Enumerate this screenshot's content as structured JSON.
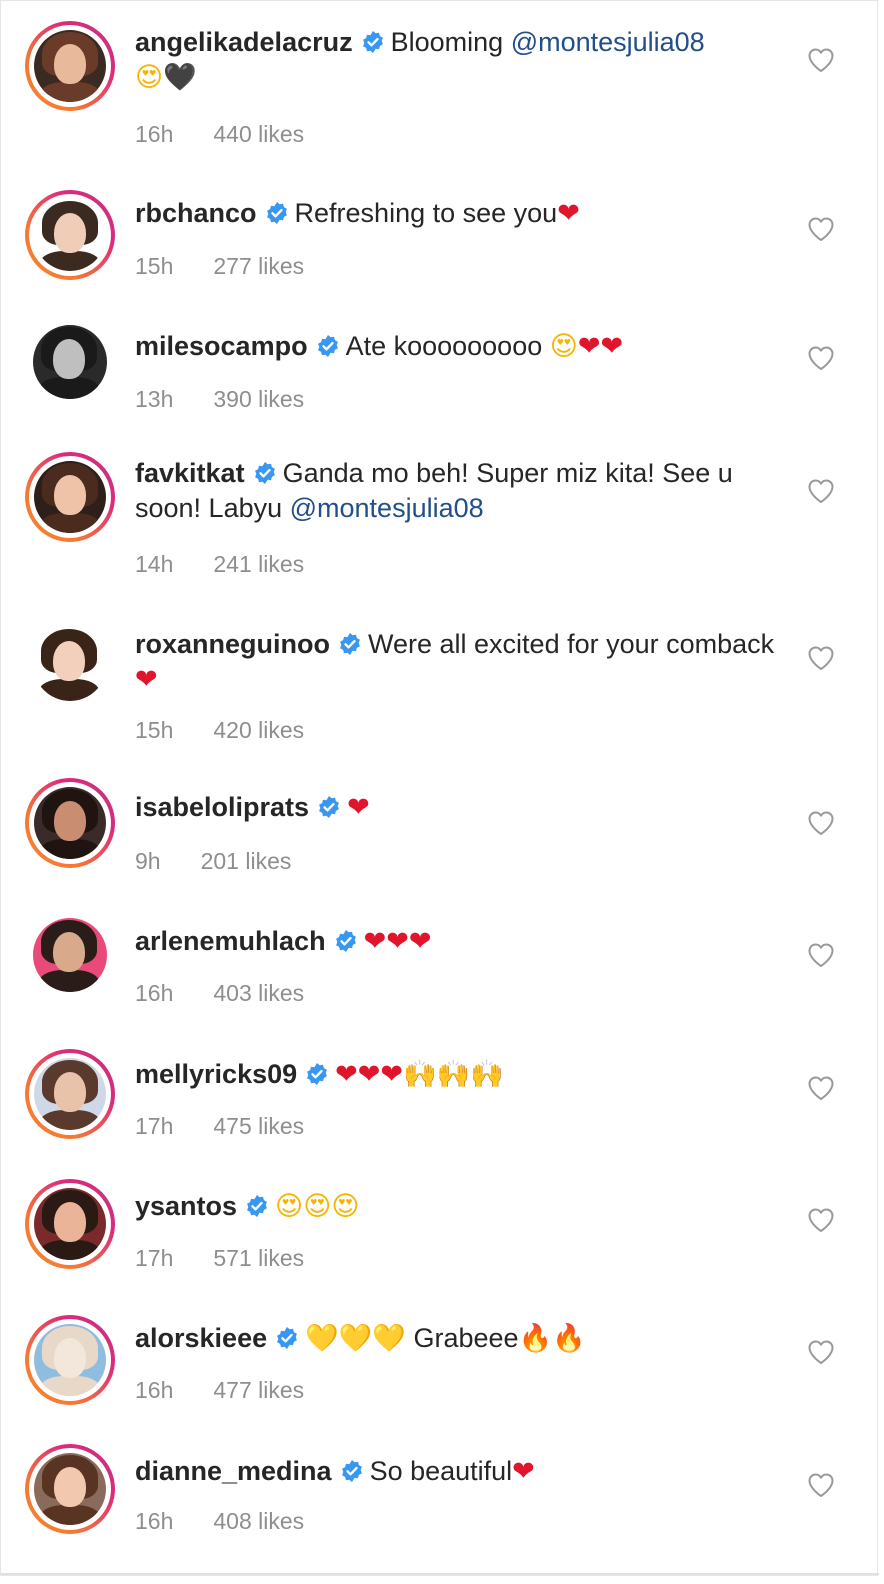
{
  "comments": [
    {
      "username": "angelikadelacruz",
      "text": "Blooming ",
      "mention": "@montesjulia08",
      "emoji": [
        {
          "char": "😍",
          "color": "#f5b400"
        },
        {
          "char": "🖤",
          "color": "#111111"
        }
      ],
      "time": "16h",
      "likes": "440 likes",
      "story_ring": true
    },
    {
      "username": "rbchanco",
      "text": "Refreshing to see you",
      "mention": "",
      "emoji": [
        {
          "char": "❤",
          "color": "#e0142b"
        }
      ],
      "time": "15h",
      "likes": "277 likes",
      "story_ring": true
    },
    {
      "username": "milesocampo",
      "text": "Ate kooooooooo ",
      "mention": "",
      "emoji": [
        {
          "char": "😍",
          "color": "#f5b400"
        },
        {
          "char": "❤",
          "color": "#e0142b"
        },
        {
          "char": "❤",
          "color": "#e0142b"
        }
      ],
      "time": "13h",
      "likes": "390 likes",
      "story_ring": false
    },
    {
      "username": "favkitkat",
      "text": "Ganda mo beh! Super miz kita! See u soon! Labyu ",
      "mention": "@montesjulia08",
      "emoji": [],
      "time": "14h",
      "likes": "241 likes",
      "story_ring": true
    },
    {
      "username": "roxanneguinoo",
      "text": "Were all excited for your comback",
      "mention": "",
      "emoji": [
        {
          "char": "❤",
          "color": "#e0142b"
        }
      ],
      "time": "15h",
      "likes": "420 likes",
      "story_ring": false
    },
    {
      "username": "isabeloliprats",
      "text": "",
      "mention": "",
      "emoji": [
        {
          "char": "❤",
          "color": "#e0142b"
        }
      ],
      "time": "9h",
      "likes": "201 likes",
      "story_ring": true
    },
    {
      "username": "arlenemuhlach",
      "text": "",
      "mention": "",
      "emoji": [
        {
          "char": "❤",
          "color": "#e0142b"
        },
        {
          "char": "❤",
          "color": "#e0142b"
        },
        {
          "char": "❤",
          "color": "#e0142b"
        }
      ],
      "time": "16h",
      "likes": "403 likes",
      "story_ring": false
    },
    {
      "username": "mellyricks09",
      "text": "",
      "mention": "",
      "emoji": [
        {
          "char": "❤",
          "color": "#e0142b"
        },
        {
          "char": "❤",
          "color": "#e0142b"
        },
        {
          "char": "❤",
          "color": "#e0142b"
        },
        {
          "char": "🙌",
          "color": "#f4c20d"
        },
        {
          "char": "🙌",
          "color": "#f4c20d"
        },
        {
          "char": "🙌",
          "color": "#f4c20d"
        }
      ],
      "time": "17h",
      "likes": "475 likes",
      "story_ring": true
    },
    {
      "username": "ysantos",
      "text": "",
      "mention": "",
      "emoji": [
        {
          "char": "😍",
          "color": "#f5b400"
        },
        {
          "char": "😍",
          "color": "#f5b400"
        },
        {
          "char": "😍",
          "color": "#f5b400"
        }
      ],
      "time": "17h",
      "likes": "571 likes",
      "story_ring": true
    },
    {
      "username": "alorskieee",
      "text": "",
      "mention": "",
      "emoji": [
        {
          "char": "💛",
          "color": "#f4c20d"
        },
        {
          "char": "💛",
          "color": "#f4c20d"
        },
        {
          "char": "💛",
          "color": "#f4c20d"
        }
      ],
      "text_after": " Grabeee",
      "emoji_after": [
        {
          "char": "🔥",
          "color": "#f26a1b"
        },
        {
          "char": "🔥",
          "color": "#f26a1b"
        }
      ],
      "time": "16h",
      "likes": "477 likes",
      "story_ring": true
    },
    {
      "username": "dianne_medina",
      "text": "So beautiful",
      "mention": "",
      "emoji": [
        {
          "char": "❤",
          "color": "#e0142b"
        }
      ],
      "time": "16h",
      "likes": "408 likes",
      "story_ring": true
    }
  ],
  "colors": {
    "text": "#262626",
    "meta": "#8e8e8e",
    "mention": "#224f8a",
    "verified": "#3897f0",
    "heart_outline": "#999999"
  },
  "icons": {
    "verified": "verified-badge-icon",
    "like": "heart-outline-icon"
  }
}
